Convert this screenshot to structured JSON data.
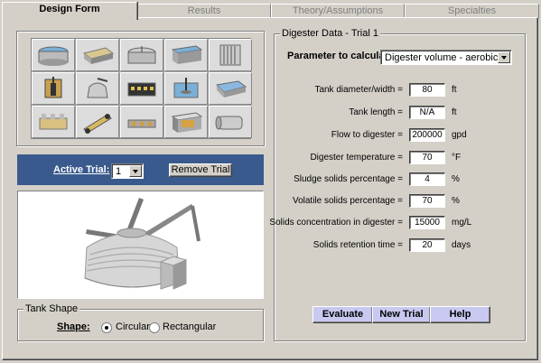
{
  "tabs": [
    "Design Form",
    "Results",
    "Theory/Assumptions",
    "Specialties"
  ],
  "trial": {
    "label": "Active Trial:",
    "value": "1",
    "remove_label": "Remove Trial"
  },
  "tank_shape": {
    "title": "Tank Shape",
    "shape_label": "Shape:",
    "options": [
      "Circular",
      "Rectangular"
    ],
    "selected": "Circular"
  },
  "digester": {
    "title": "Digester Data - Trial 1",
    "param_label": "Parameter to calculate:",
    "param_value": "Digester volume - aerobic",
    "rows": [
      {
        "label": "Tank diameter/width =",
        "value": "80",
        "unit": "ft"
      },
      {
        "label": "Tank length =",
        "value": "N/A",
        "unit": "ft"
      },
      {
        "label": "Flow to digester =",
        "value": "200000",
        "unit": "gpd"
      },
      {
        "label": "Digester temperature =",
        "value": "70",
        "unit": "°F"
      },
      {
        "label": "Sludge solids percentage =",
        "value": "4",
        "unit": "%"
      },
      {
        "label": "Volatile solids percentage =",
        "value": "70",
        "unit": "%"
      },
      {
        "label": "Solids concentration in digester =",
        "value": "15000",
        "unit": "mg/L"
      },
      {
        "label": "Solids retention time =",
        "value": "20",
        "unit": "days"
      }
    ]
  },
  "actions": [
    "Evaluate",
    "New Trial",
    "Help"
  ],
  "colors": {
    "trial_bar": "#3a5a8e",
    "action_button": "#c8c8f0"
  },
  "grid_icons": [
    "clarifier-icon",
    "filter-bed-icon",
    "trickling-filter-icon",
    "basin-icon",
    "screen-icon",
    "pump-icon",
    "digester-icon",
    "aeration-tank-icon",
    "mixer-icon",
    "lagoon-icon",
    "sand-filter-icon",
    "belt-press-icon",
    "conveyor-icon",
    "settling-tank-icon",
    "drum-icon"
  ]
}
